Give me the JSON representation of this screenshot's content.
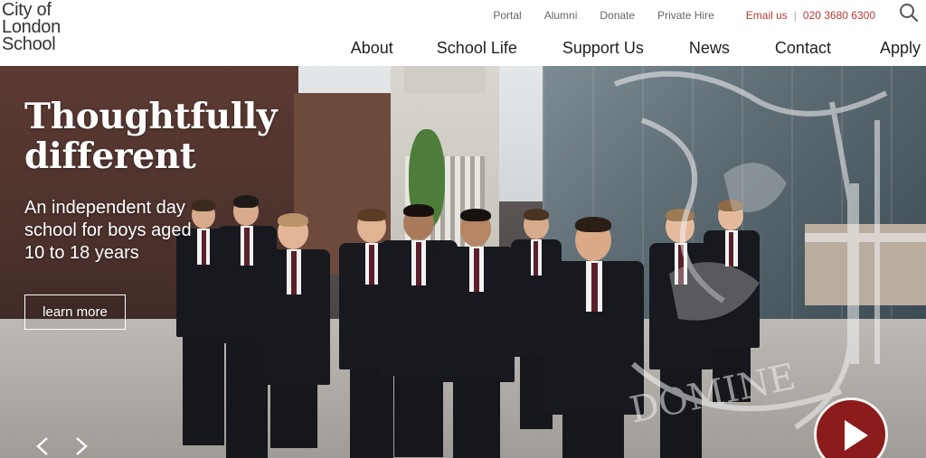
{
  "brand": {
    "logo_line1": "City of",
    "logo_line2": "London",
    "logo_line3": "School"
  },
  "utility_nav": {
    "portal": "Portal",
    "alumni": "Alumni",
    "donate": "Donate",
    "private_hire": "Private Hire",
    "email": "Email us",
    "separator": "|",
    "phone": "020 3680 6300",
    "search_icon": "search-icon"
  },
  "main_nav": {
    "items": [
      "About",
      "School Life",
      "Support Us",
      "News",
      "Contact",
      "Apply"
    ]
  },
  "hero": {
    "title_line1": "Thoughtfully",
    "title_line2": "different",
    "subtitle_line1": "An independent day",
    "subtitle_line2": "school for boys aged",
    "subtitle_line3": "10 to 18 years",
    "cta_label": "learn more",
    "prev_icon": "chevron-left-icon",
    "next_icon": "chevron-right-icon",
    "play_icon": "play-icon",
    "watermark_text": "DOMINE"
  },
  "colors": {
    "accent_red": "#8c1b1b",
    "link_red": "#b23a3a"
  }
}
